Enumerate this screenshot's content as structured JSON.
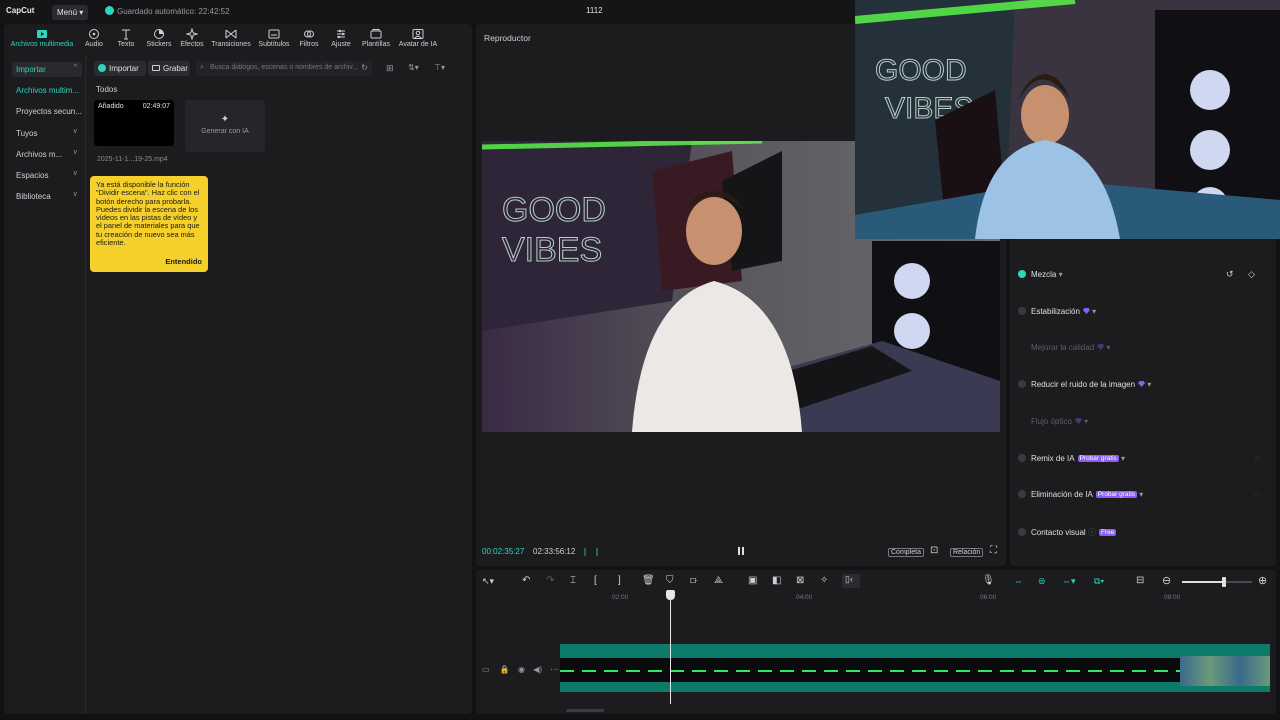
{
  "topbar": {
    "logo": "CapCut",
    "menu_label": "Menú",
    "autosave": "Guardado automático: 22:42:52",
    "project_title": "1112"
  },
  "tabs": [
    {
      "label": "Archivos multimedia",
      "icon": "media-icon",
      "active": true
    },
    {
      "label": "Audio",
      "icon": "audio-icon"
    },
    {
      "label": "Texto",
      "icon": "text-icon"
    },
    {
      "label": "Stickers",
      "icon": "sticker-icon"
    },
    {
      "label": "Efectos",
      "icon": "effects-icon"
    },
    {
      "label": "Transiciones",
      "icon": "transitions-icon"
    },
    {
      "label": "Subtítulos",
      "icon": "subtitles-icon"
    },
    {
      "label": "Filtros",
      "icon": "filters-icon"
    },
    {
      "label": "Ajuste",
      "icon": "adjust-icon"
    },
    {
      "label": "Plantillas",
      "icon": "templates-icon"
    },
    {
      "label": "Avatar de IA",
      "icon": "avatar-icon"
    }
  ],
  "sidebar": {
    "items": [
      {
        "label": "Importar",
        "selected": true,
        "chevron": "^"
      },
      {
        "label": "Archivos multim...",
        "active_text": true
      },
      {
        "label": "Proyectos secun..."
      },
      {
        "label": "Tuyos",
        "chevron": "v"
      },
      {
        "label": "Archivos m...",
        "chevron": "v"
      },
      {
        "label": "Espacios",
        "chevron": "v"
      },
      {
        "label": "Biblioteca",
        "chevron": "v"
      }
    ]
  },
  "media": {
    "import_label": "Importar",
    "record_label": "Grabar",
    "search_placeholder": "Busca diálogos, escenas o nombres de archiv...",
    "filter_label": "Todos",
    "clip": {
      "tag": "Añadido",
      "duration": "02:49:07",
      "name": "2025-11-1...19-25.mp4"
    },
    "generate_label": "Generar con IA"
  },
  "tooltip": {
    "text": "Ya está disponible la función \"Dividir escena\". Haz clic con el botón derecho para probarla. Puedes dividir la escena de los vídeos en las pistas de vídeo y el panel de materiales para que tu creación de nuevo sea más eficiente.",
    "button": "Entendido"
  },
  "player": {
    "title": "Reproductor",
    "current_time": "00:02:35:27",
    "total_time": "02:33:56:12",
    "full_label": "Completa",
    "ratio_label": "Relación"
  },
  "inspector": {
    "options": [
      {
        "label": "Mezcla",
        "checked": true
      },
      {
        "label": "Estabilización",
        "gem": true
      },
      {
        "label": "Mejorar la calidad",
        "disabled": true,
        "gem": true
      },
      {
        "label": "Reducir el ruido de la imagen",
        "gem": true
      },
      {
        "label": "Flujo óptico",
        "disabled": true,
        "gem": true
      },
      {
        "label": "Remix de IA",
        "badge": "Probar gratis"
      },
      {
        "label": "Eliminación de IA",
        "badge": "Probar gratis"
      },
      {
        "label": "Contacto visual",
        "badge": "Free"
      }
    ]
  },
  "timeline": {
    "ruler": [
      "02:00",
      "04:00",
      "06:00",
      "08:00"
    ],
    "playhead_fraction": 0.155,
    "zoom_level": 0.6
  },
  "colors": {
    "accent": "#2dd4bf",
    "tooltip": "#f5cf2a",
    "track": "#0d7a6a",
    "premium": "#8b5cf6"
  }
}
